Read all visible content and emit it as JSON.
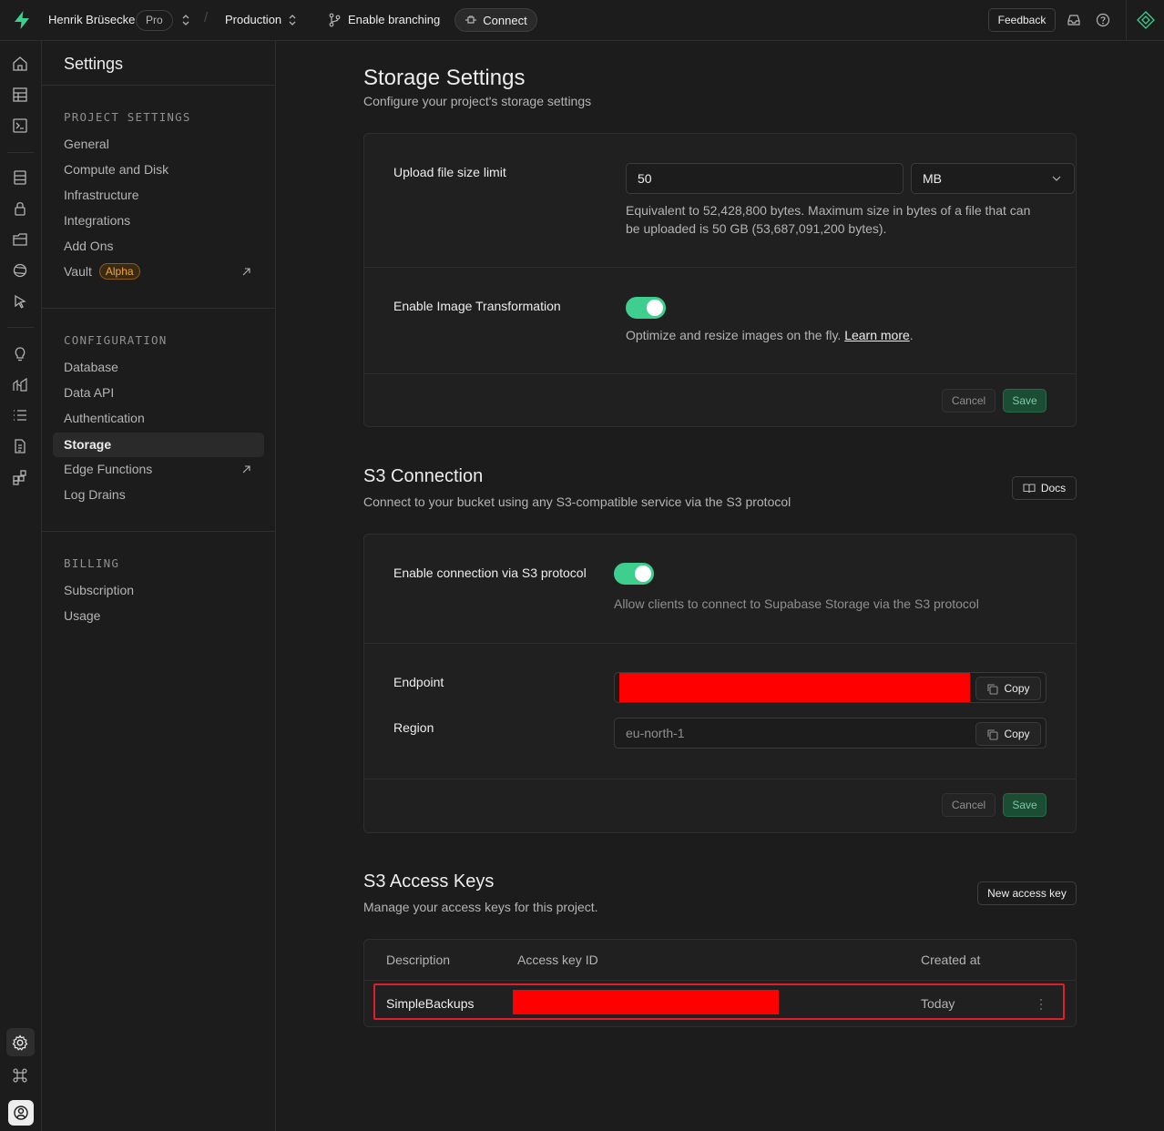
{
  "topbar": {
    "org_name": "Henrik Brüsecke",
    "plan_badge": "Pro",
    "project_name": "Production",
    "branching_label": "Enable branching",
    "connect_label": "Connect",
    "feedback_label": "Feedback"
  },
  "sidebar": {
    "title": "Settings",
    "sections": [
      {
        "heading": "PROJECT SETTINGS",
        "items": [
          {
            "label": "General"
          },
          {
            "label": "Compute and Disk"
          },
          {
            "label": "Infrastructure"
          },
          {
            "label": "Integrations"
          },
          {
            "label": "Add Ons"
          },
          {
            "label": "Vault",
            "badge": "Alpha"
          }
        ]
      },
      {
        "heading": "CONFIGURATION",
        "items": [
          {
            "label": "Database"
          },
          {
            "label": "Data API"
          },
          {
            "label": "Authentication"
          },
          {
            "label": "Storage"
          },
          {
            "label": "Edge Functions"
          },
          {
            "label": "Log Drains"
          }
        ]
      },
      {
        "heading": "BILLING",
        "items": [
          {
            "label": "Subscription"
          },
          {
            "label": "Usage"
          }
        ]
      }
    ]
  },
  "storage_settings": {
    "title": "Storage Settings",
    "subtitle": "Configure your project's storage settings",
    "upload_limit": {
      "label": "Upload file size limit",
      "value": "50",
      "unit": "MB",
      "help_line1": "Equivalent to 52,428,800 bytes. Maximum size in bytes of a file that can",
      "help_line2": "be uploaded is 50 GB (53,687,091,200 bytes)."
    },
    "image_transformation": {
      "label": "Enable Image Transformation",
      "enabled": true,
      "help": "Optimize and resize images on the fly.",
      "learn_more": "Learn more",
      "period": "."
    },
    "cancel_label": "Cancel",
    "save_label": "Save"
  },
  "s3_connection": {
    "title": "S3 Connection",
    "subtitle": "Connect to your bucket using any S3-compatible service via the S3 protocol",
    "docs_label": "Docs",
    "enable_label": "Enable connection via S3 protocol",
    "enabled": true,
    "enable_help": "Allow clients to connect to Supabase Storage via the S3 protocol",
    "endpoint_label": "Endpoint",
    "region_label": "Region",
    "region_value": "eu-north-1",
    "copy_label": "Copy",
    "cancel_label": "Cancel",
    "save_label": "Save"
  },
  "s3_access_keys": {
    "title": "S3 Access Keys",
    "subtitle": "Manage your access keys for this project.",
    "new_key_label": "New access key",
    "columns": [
      "Description",
      "Access key ID",
      "Created at"
    ],
    "rows": [
      {
        "description": "SimpleBackups",
        "created_at": "Today"
      }
    ]
  },
  "colors": {
    "accent": "#3ecf8e",
    "redaction": "#ff0000",
    "highlight_outline": "#e11d2b"
  }
}
